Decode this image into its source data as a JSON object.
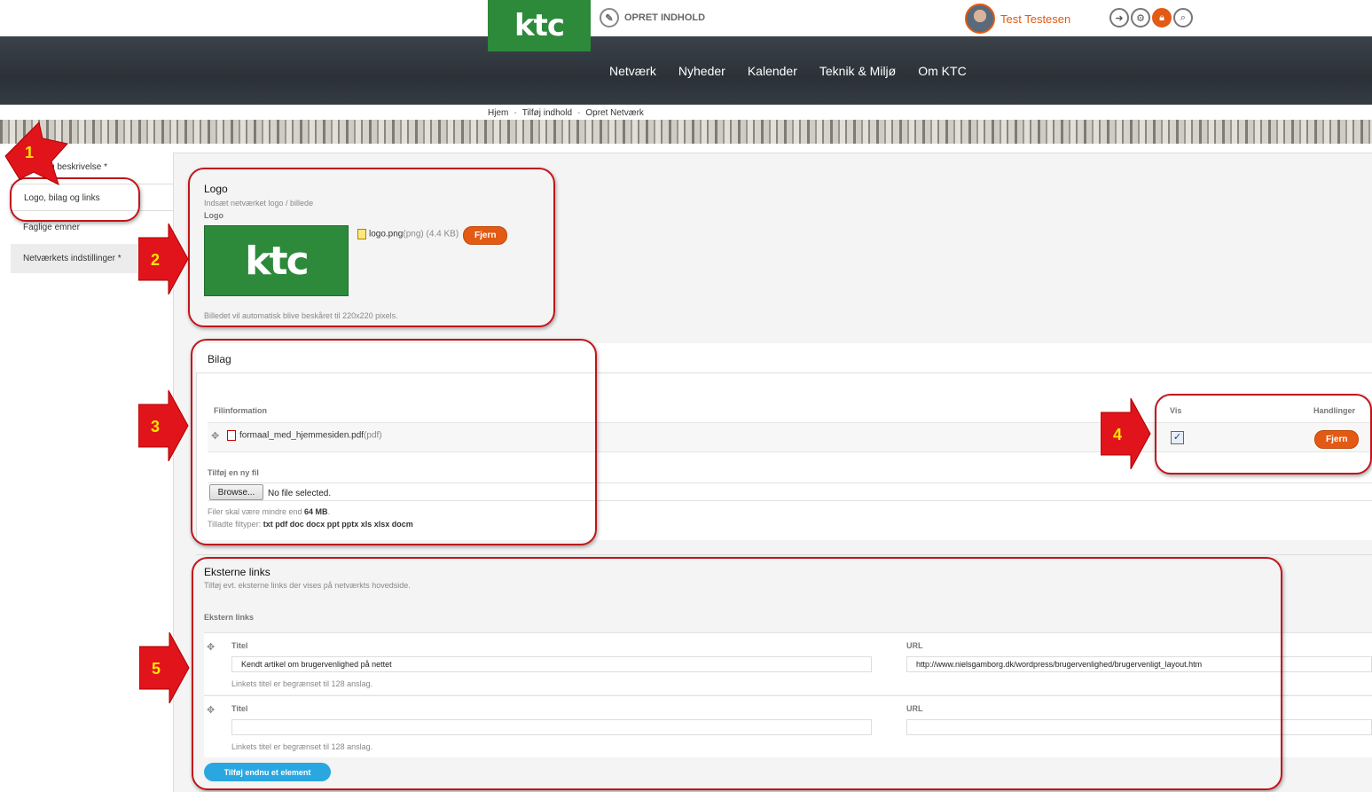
{
  "brand": {
    "logo_text": "ktc",
    "opret_label": "OPRET INDHOLD"
  },
  "user": {
    "name": "Test Testesen"
  },
  "top_icons": [
    "pin-icon",
    "gear-icon",
    "lock-icon",
    "search-icon"
  ],
  "nav": [
    "Netværk",
    "Nyheder",
    "Kalender",
    "Teknik & Miljø",
    "Om KTC"
  ],
  "breadcrumb": [
    "Hjem",
    "Tilføj indhold",
    "Opret Netværk"
  ],
  "sidebar": {
    "tabs": [
      {
        "label": "Titel og beskrivelse *",
        "visible": "g beskrivelse *"
      },
      {
        "label": "Logo, bilag og links"
      },
      {
        "label": "Faglige emner"
      },
      {
        "label": "Netværkets indstillinger *"
      }
    ]
  },
  "logo_section": {
    "title": "Logo",
    "subtitle": "Indsæt netværket logo / billede",
    "field_label": "Logo",
    "image_text": "ktc",
    "file_name": "logo.png",
    "file_meta": "(png) (4.4 KB)",
    "remove_label": "Fjern",
    "note": "Billedet vil automatisk blive beskåret til 220x220 pixels."
  },
  "bilag": {
    "title": "Bilag",
    "col_file": "Filinformation",
    "col_show": "Vis",
    "col_actions": "Handlinger",
    "file_name": "formaal_med_hjemmesiden.pdf",
    "file_type": "(pdf)",
    "remove_label": "Fjern",
    "add_label": "Tilføj en ny fil",
    "browse_label": "Browse...",
    "no_file": "No file selected.",
    "size_note_pre": "Filer skal være mindre end ",
    "size_note_val": "64 MB",
    "size_note_post": ".",
    "types_pre": "Tilladte filtyper: ",
    "types_val": "txt pdf doc docx ppt pptx xls xlsx docm"
  },
  "links": {
    "title": "Eksterne links",
    "subtitle": "Tilføj evt. eksterne links der vises på netværkts hovedside.",
    "field_label": "Ekstern links",
    "title_label": "Titel",
    "url_label": "URL",
    "row1_title": "Kendt artikel om brugervenlighed på nettet",
    "row1_url": "http://www.nielsgamborg.dk/wordpress/brugervenlighed/brugervenligt_layout.htm",
    "limit_note": "Linkets titel er begrænset til 128 anslag.",
    "add_more": "Tilføj endnu et element"
  },
  "annotations": [
    "1",
    "2",
    "3",
    "4",
    "5"
  ],
  "colors": {
    "accent": "#e25a14",
    "brand_green": "#2c8a3a",
    "annotation_red": "#c0151b",
    "annotation_yellow": "#ffe400",
    "add_button": "#2aa7e0"
  }
}
